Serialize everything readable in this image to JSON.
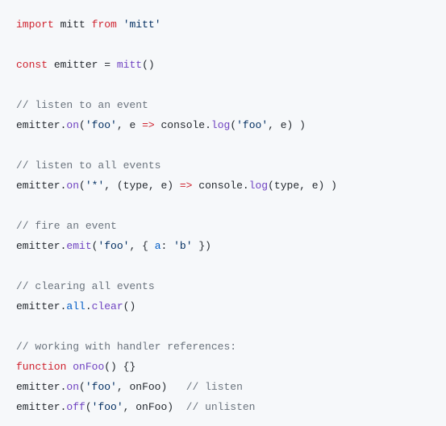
{
  "code": {
    "l1": {
      "import": "import",
      "mitt": "mitt",
      "from": "from",
      "str": "'mitt'"
    },
    "l3": {
      "const": "const",
      "emitter": "emitter",
      "eq": " = ",
      "mitt": "mitt",
      "paren": "()"
    },
    "l5": {
      "com": "// listen to an event"
    },
    "l6": {
      "a": "emitter.",
      "on": "on",
      "b": "(",
      "s1": "'foo'",
      "c": ", e ",
      "arrow": "=>",
      "d": " console.",
      "log": "log",
      "e": "(",
      "s2": "'foo'",
      "f": ", e) )"
    },
    "l8": {
      "com": "// listen to all events"
    },
    "l9": {
      "a": "emitter.",
      "on": "on",
      "b": "(",
      "s1": "'*'",
      "c": ", (type, e) ",
      "arrow": "=>",
      "d": " console.",
      "log": "log",
      "e": "(type, e) )"
    },
    "l11": {
      "com": "// fire an event"
    },
    "l12": {
      "a": "emitter.",
      "emit": "emit",
      "b": "(",
      "s1": "'foo'",
      "c": ", { ",
      "key": "a",
      "colon": ": ",
      "s2": "'b'",
      "d": " })"
    },
    "l14": {
      "com": "// clearing all events"
    },
    "l15": {
      "a": "emitter.",
      "all": "all",
      "b": ".",
      "clear": "clear",
      "c": "()"
    },
    "l17": {
      "com": "// working with handler references:"
    },
    "l18": {
      "fn": "function",
      "sp": " ",
      "name": "onFoo",
      "rest": "() {}"
    },
    "l19": {
      "a": "emitter.",
      "on": "on",
      "b": "(",
      "s1": "'foo'",
      "c": ", onFoo)   ",
      "com": "// listen"
    },
    "l20": {
      "a": "emitter.",
      "off": "off",
      "b": "(",
      "s1": "'foo'",
      "c": ", onFoo)  ",
      "com": "// unlisten"
    }
  }
}
